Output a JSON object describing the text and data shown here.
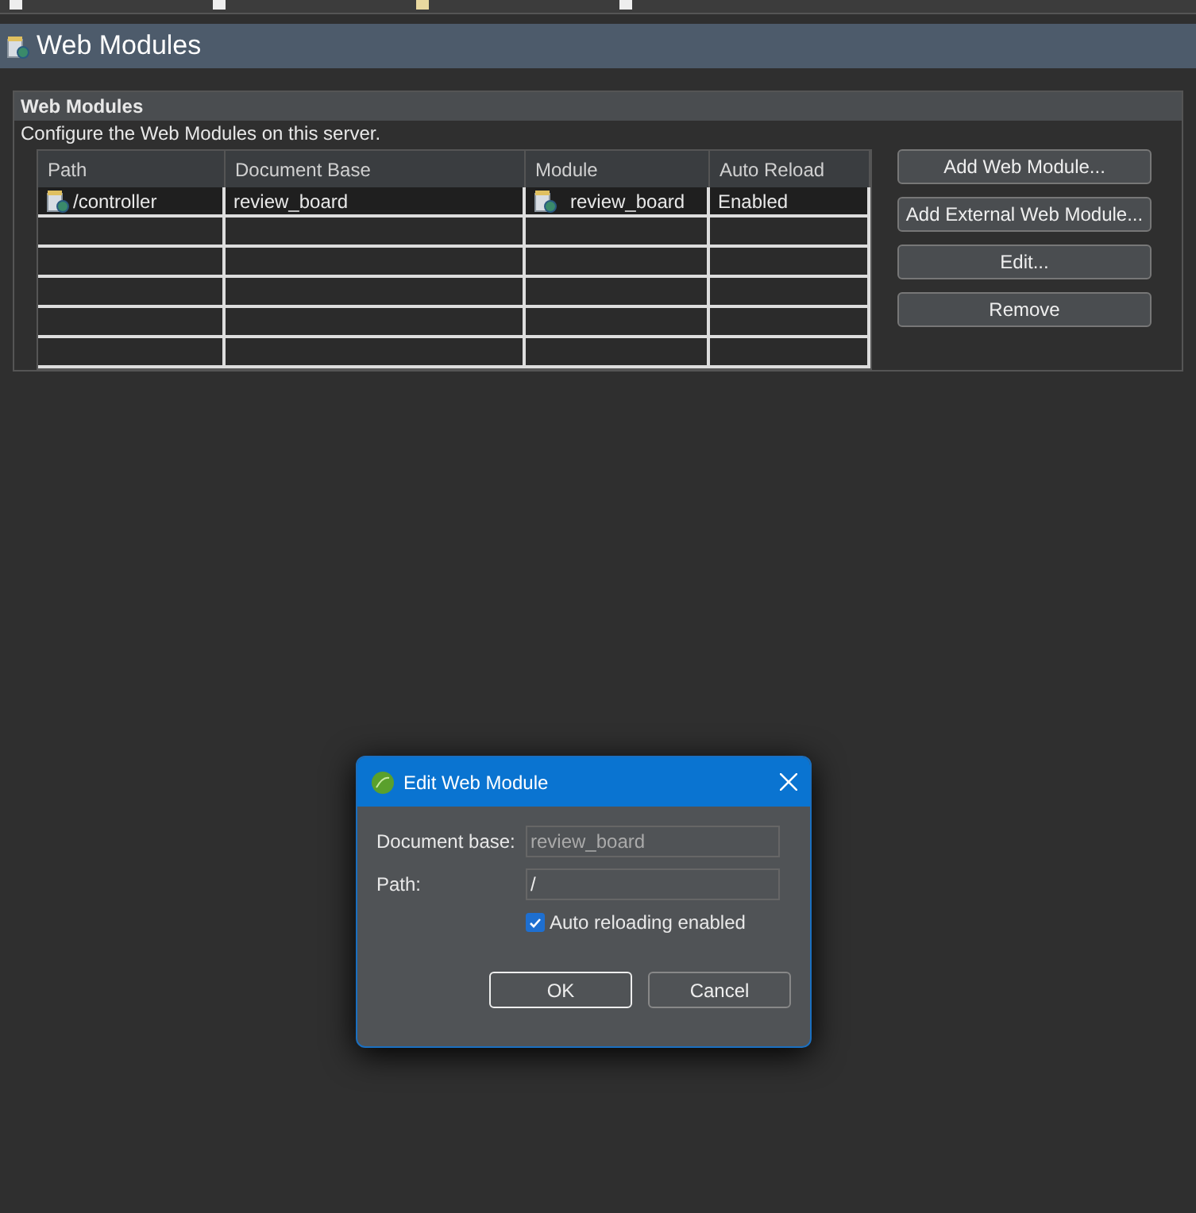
{
  "editor": {
    "title": "Web Modules"
  },
  "section": {
    "title": "Web Modules",
    "description": "Configure the Web Modules on this server."
  },
  "table": {
    "columns": [
      "Path",
      "Document Base",
      "Module",
      "Auto Reload"
    ],
    "rows": [
      {
        "cells": [
          {
            "text": "/controller",
            "kind": "module"
          },
          {
            "text": "review_board",
            "kind": "plain"
          },
          {
            "text": "review_board",
            "kind": "module"
          },
          {
            "text": "Enabled",
            "kind": "plain"
          }
        ],
        "selected": true
      }
    ]
  },
  "buttons": [
    "Add Web Module...",
    "Add External Web Module...",
    "Edit...",
    "Remove"
  ],
  "dialog": {
    "title": "Edit Web Module",
    "fields": [
      {
        "label": "Document base:",
        "value": "review_board",
        "disabled": true
      },
      {
        "label": "Path:",
        "value": "/",
        "disabled": false
      }
    ],
    "checkbox": {
      "label": "Auto reloading enabled",
      "checked": true
    },
    "buttons": [
      {
        "label": "OK",
        "default": true
      },
      {
        "label": "Cancel",
        "default": false
      }
    ]
  }
}
